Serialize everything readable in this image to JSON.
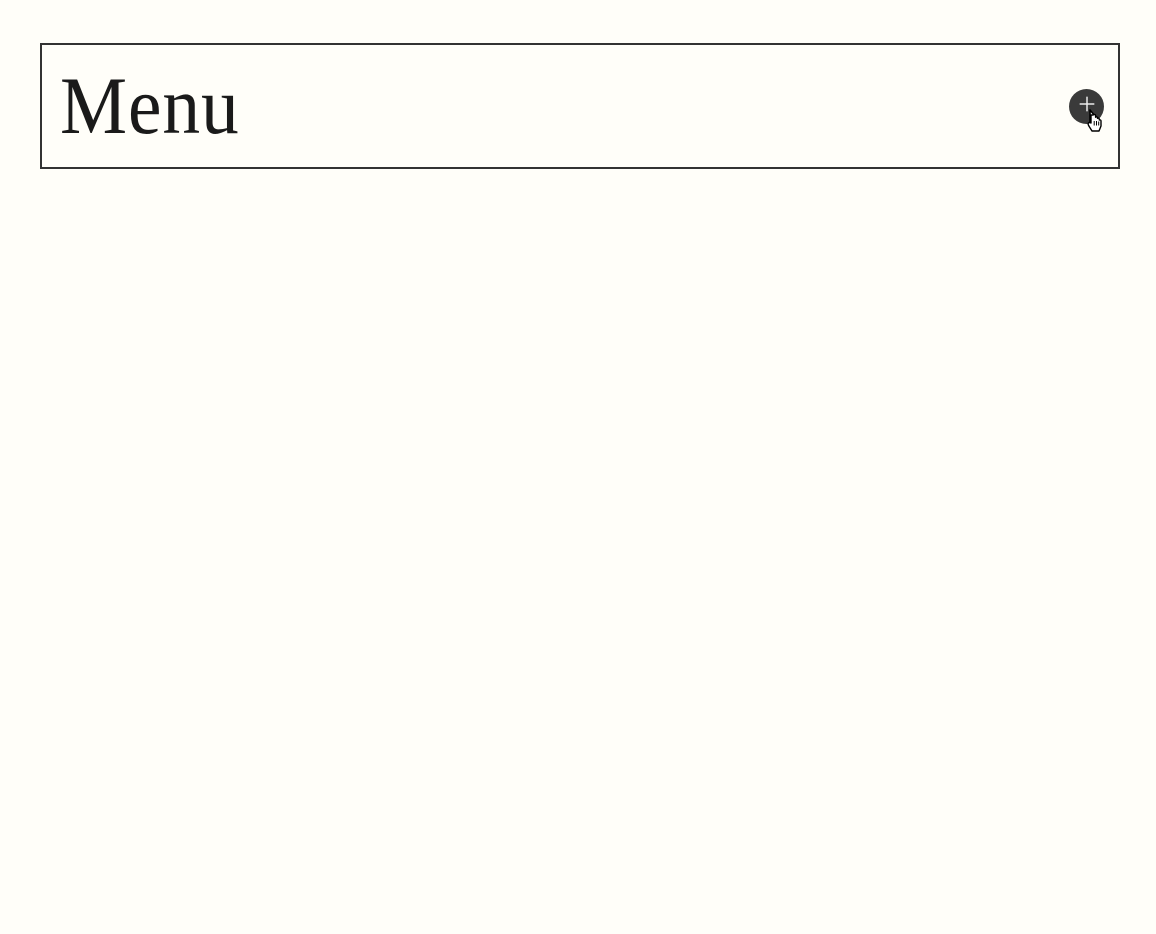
{
  "panel": {
    "title": "Menu",
    "expand_icon": "plus-circle"
  }
}
